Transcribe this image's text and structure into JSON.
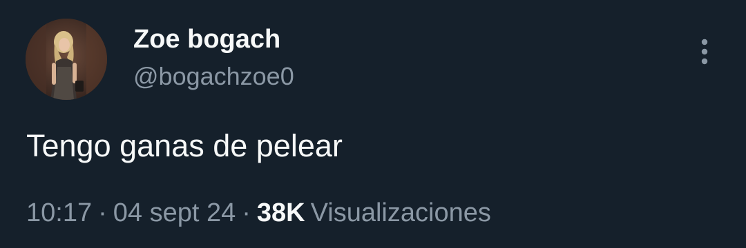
{
  "author": {
    "display_name": "Zoe bogach",
    "handle": "@bogachzoe0",
    "avatar_icon": "profile-photo"
  },
  "tweet": {
    "text": "Tengo ganas de pelear"
  },
  "meta": {
    "time": "10:17",
    "separator": "·",
    "date": "04 sept 24",
    "views_count": "38K",
    "views_label": "Visualizaciones"
  },
  "menu": {
    "icon": "more-vertical-icon"
  },
  "colors": {
    "background": "#15202b",
    "primary_text": "#f7f9f9",
    "secondary_text": "#8b98a5"
  }
}
